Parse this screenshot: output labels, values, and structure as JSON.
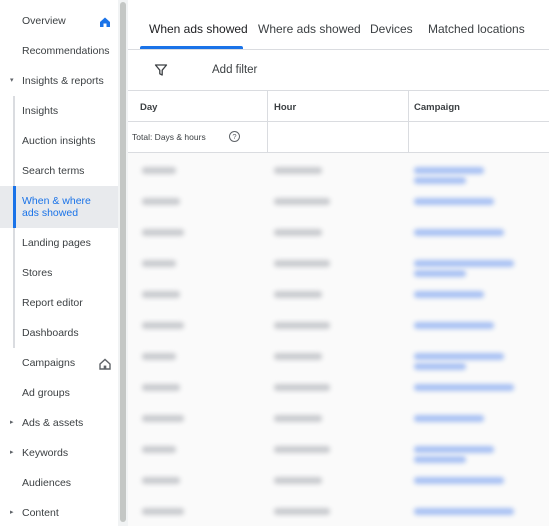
{
  "sidebar": {
    "items": [
      {
        "label": "Overview",
        "arrow": "",
        "home": true
      },
      {
        "label": "Recommendations",
        "arrow": "",
        "home": false
      },
      {
        "label": "Insights & reports",
        "arrow": "▾",
        "home": false
      },
      {
        "label": "Insights",
        "arrow": "",
        "home": false
      },
      {
        "label": "Auction insights",
        "arrow": "",
        "home": false
      },
      {
        "label": "Search terms",
        "arrow": "",
        "home": false
      },
      {
        "label": "When & where ads showed",
        "arrow": "",
        "home": false,
        "active": true
      },
      {
        "label": "Landing pages",
        "arrow": "",
        "home": false
      },
      {
        "label": "Stores",
        "arrow": "",
        "home": false
      },
      {
        "label": "Report editor",
        "arrow": "",
        "home": false
      },
      {
        "label": "Dashboards",
        "arrow": "",
        "home": false
      },
      {
        "label": "Campaigns",
        "arrow": "",
        "home": true
      },
      {
        "label": "Ad groups",
        "arrow": "",
        "home": false
      },
      {
        "label": "Ads & assets",
        "arrow": "▸",
        "home": false
      },
      {
        "label": "Keywords",
        "arrow": "▸",
        "home": false
      },
      {
        "label": "Audiences",
        "arrow": "",
        "home": false
      },
      {
        "label": "Content",
        "arrow": "▸",
        "home": false
      }
    ]
  },
  "tabs": [
    {
      "label": "When ads showed",
      "active": true
    },
    {
      "label": "Where ads showed",
      "active": false
    },
    {
      "label": "Devices",
      "active": false
    },
    {
      "label": "Matched locations",
      "active": false
    }
  ],
  "filter": {
    "add_label": "Add filter"
  },
  "table": {
    "headers": [
      "Day",
      "Hour",
      "Campaign"
    ],
    "total_label": "Total: Days & hours",
    "help_glyph": "?"
  },
  "colors": {
    "accent": "#1a73e8",
    "active_bg": "#e8eaed",
    "divider": "#dadce0"
  }
}
